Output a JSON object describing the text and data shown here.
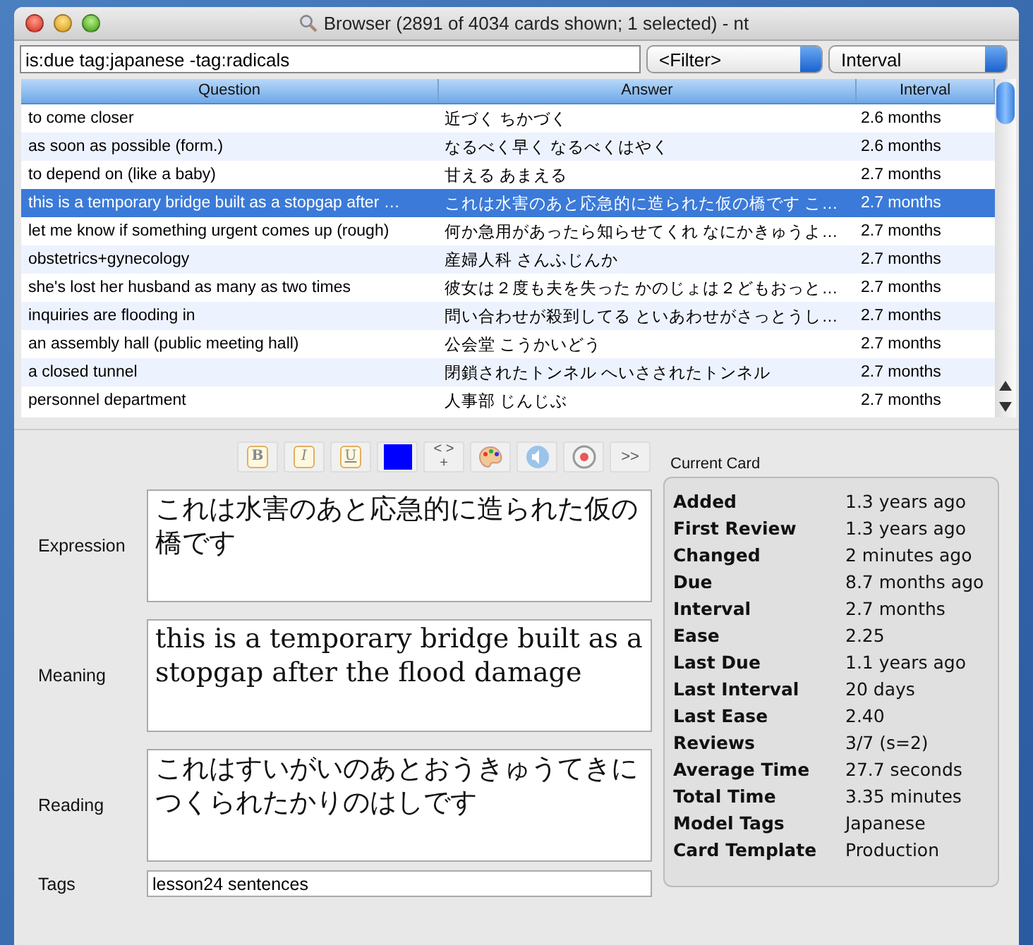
{
  "window": {
    "title": "Browser (2891 of 4034 cards shown; 1 selected) - nt"
  },
  "search": {
    "value": "is:due tag:japanese -tag:radicals"
  },
  "filter_dropdown": {
    "value": "<Filter>"
  },
  "sort_dropdown": {
    "value": "Interval"
  },
  "table": {
    "columns": [
      "Question",
      "Answer",
      "Interval"
    ],
    "rows": [
      {
        "question": "to come closer",
        "answer": "近づく ちかづく",
        "interval": "2.6 months",
        "selected": false
      },
      {
        "question": "as soon as possible (form.)",
        "answer": "なるべく早く なるべくはやく",
        "interval": "2.6 months",
        "selected": false
      },
      {
        "question": "to depend on (like a baby)",
        "answer": "甘える あまえる",
        "interval": "2.7 months",
        "selected": false
      },
      {
        "question": "this is a temporary bridge built as a stopgap after …",
        "answer": "これは水害のあと応急的に造られた仮の橋です こ…",
        "interval": "2.7 months",
        "selected": true
      },
      {
        "question": "let me know if something urgent comes up (rough)",
        "answer": "何か急用があったら知らせてくれ なにかきゅうよ…",
        "interval": "2.7 months",
        "selected": false
      },
      {
        "question": "obstetrics+gynecology",
        "answer": "産婦人科 さんふじんか",
        "interval": "2.7 months",
        "selected": false
      },
      {
        "question": "she's lost her husband as many as two times",
        "answer": "彼女は２度も夫を失った かのじょは２どもおっと…",
        "interval": "2.7 months",
        "selected": false
      },
      {
        "question": "inquiries are flooding in",
        "answer": "問い合わせが殺到してる といあわせがさっとうし…",
        "interval": "2.7 months",
        "selected": false
      },
      {
        "question": "an assembly hall (public meeting hall)",
        "answer": "公会堂 こうかいどう",
        "interval": "2.7 months",
        "selected": false
      },
      {
        "question": "a closed tunnel",
        "answer": "閉鎖されたトンネル へいさされたトンネル",
        "interval": "2.7 months",
        "selected": false
      },
      {
        "question": "personnel department",
        "answer": "人事部 じんじぶ",
        "interval": "2.7 months",
        "selected": false
      }
    ]
  },
  "toolbar": [
    {
      "kind": "bold",
      "label": "B"
    },
    {
      "kind": "italic",
      "label": "I"
    },
    {
      "kind": "underline",
      "label": "U"
    },
    {
      "kind": "color",
      "color": "#0000ff"
    },
    {
      "kind": "cloze",
      "label": "< >",
      "sub": "+"
    },
    {
      "kind": "palette"
    },
    {
      "kind": "sound"
    },
    {
      "kind": "record"
    },
    {
      "kind": "more",
      "label": ">>"
    }
  ],
  "fields": [
    {
      "label": "Expression",
      "value": "これは水害のあと応急的に造られた仮の橋です",
      "kind": "large"
    },
    {
      "label": "Meaning",
      "value": "this is a temporary bridge built as a stopgap after the flood damage",
      "kind": "large"
    },
    {
      "label": "Reading",
      "value": "これはすいがいのあとおうきゅうてきにつくられたかりのはしです",
      "kind": "large"
    },
    {
      "label": "Tags",
      "value": "lesson24 sentences",
      "kind": "line"
    }
  ],
  "current_card": {
    "title": "Current Card",
    "stats": [
      {
        "label": "Added",
        "value": "1.3 years ago"
      },
      {
        "label": "First Review",
        "value": "1.3 years ago"
      },
      {
        "label": "Changed",
        "value": "2 minutes ago"
      },
      {
        "label": "Due",
        "value": "8.7 months ago"
      },
      {
        "label": "Interval",
        "value": "2.7 months"
      },
      {
        "label": "Ease",
        "value": "2.25"
      },
      {
        "label": "Last Due",
        "value": "1.1 years ago"
      },
      {
        "label": "Last Interval",
        "value": "20 days"
      },
      {
        "label": "Last Ease",
        "value": "2.40"
      },
      {
        "label": "Reviews",
        "value": "3/7 (s=2)"
      },
      {
        "label": "Average Time",
        "value": "27.7 seconds"
      },
      {
        "label": "Total Time",
        "value": "3.35 minutes"
      },
      {
        "label": "Model Tags",
        "value": "Japanese"
      },
      {
        "label": "Card Template",
        "value": "Production"
      }
    ]
  }
}
